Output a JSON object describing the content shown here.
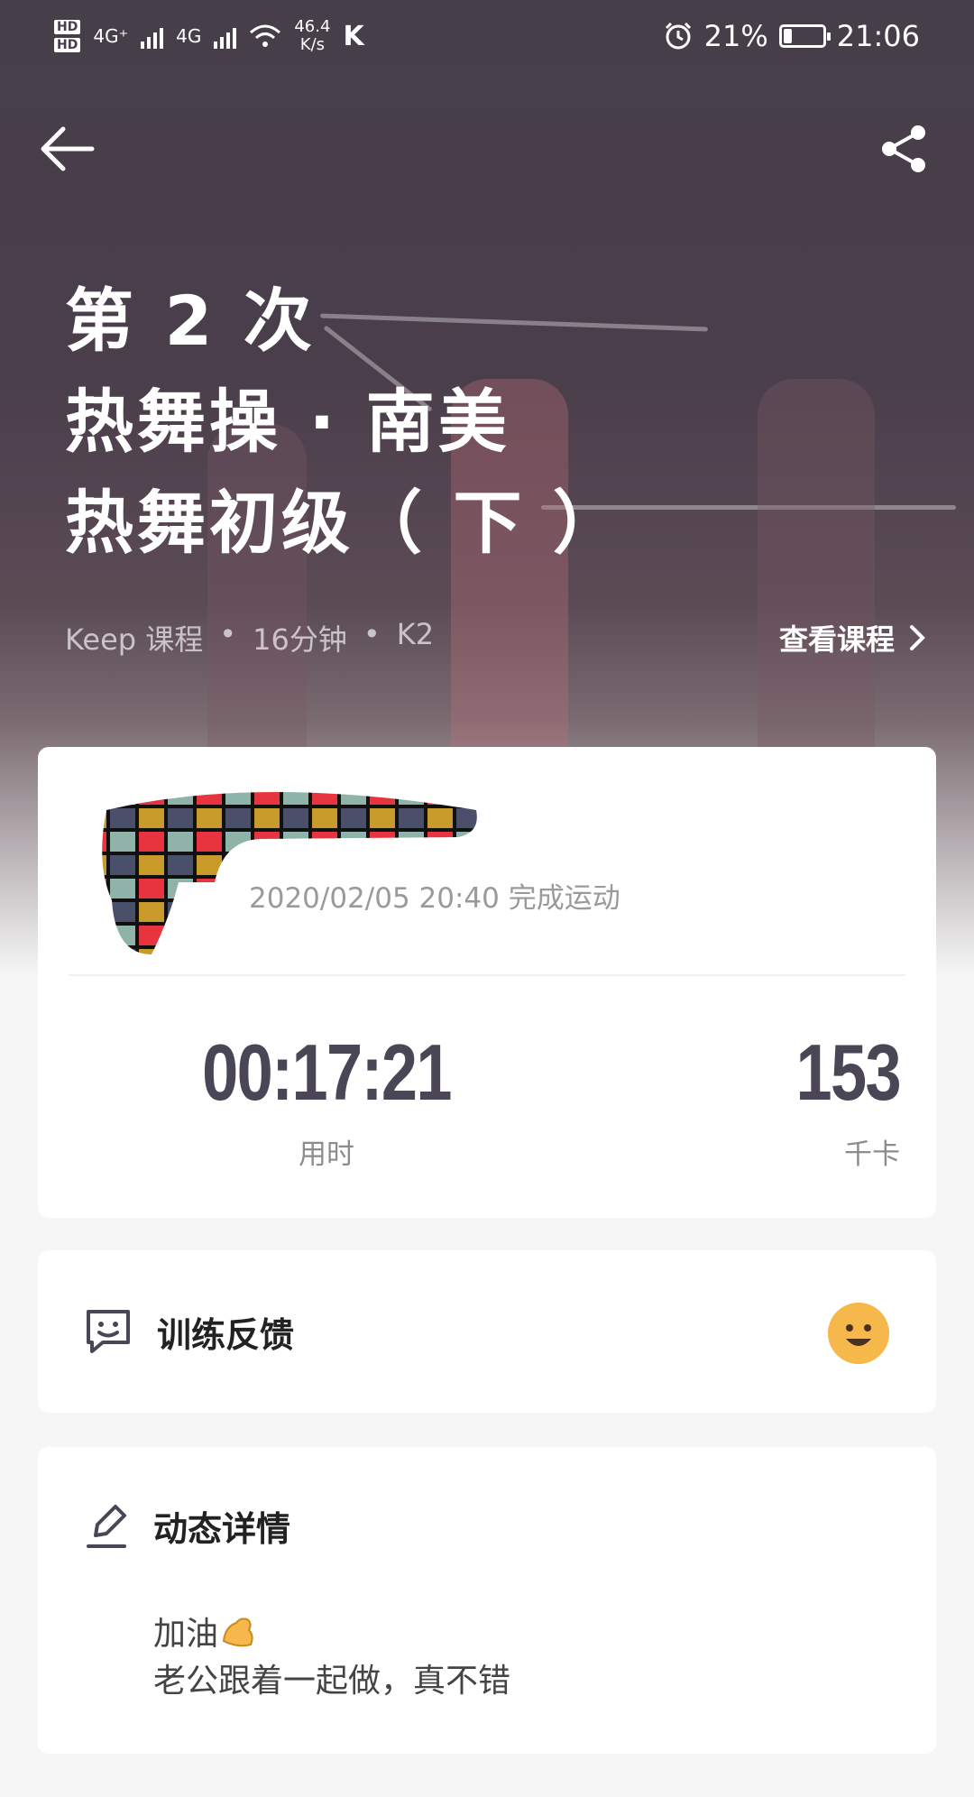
{
  "status_bar": {
    "hd1": "HD",
    "hd2": "HD",
    "net_type_1": "4G⁺",
    "net_type_2": "4G",
    "speed_value": "46.4",
    "speed_unit": "K/s",
    "app_glyph": "K",
    "battery_percent": "21%",
    "battery_level": 0.21,
    "time": "21:06"
  },
  "hero": {
    "title_lines": [
      "第 2 次",
      "热舞操 · 南美",
      "热舞初级（ 下 ）"
    ],
    "meta": {
      "source": "Keep 课程",
      "duration": "16分钟",
      "level": "K2",
      "separator": "•"
    },
    "view_course_label": "查看课程"
  },
  "summary": {
    "completed_at": "2020/02/05 20:40 完成运动",
    "time_value": "00:17:21",
    "time_label": "用时",
    "calories_value": "153",
    "calories_label": "千卡"
  },
  "feedback": {
    "title": "训练反馈"
  },
  "detail": {
    "title": "动态详情",
    "line1": "加油",
    "line2": "老公跟着一起做，真不错"
  },
  "colors": {
    "hero_bg": "#463f4a",
    "stat_text": "#4b4656",
    "emoji": "#f7b84b"
  }
}
